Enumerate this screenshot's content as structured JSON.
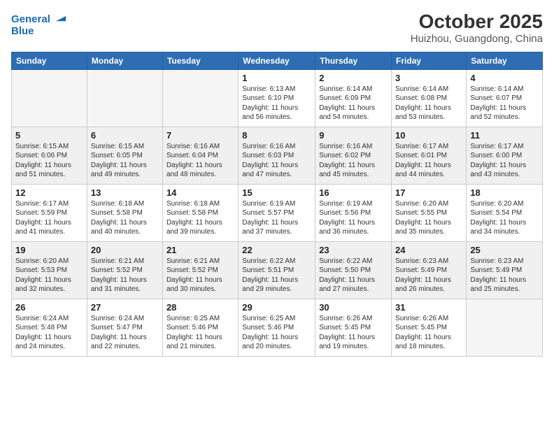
{
  "header": {
    "logo_line1": "General",
    "logo_line2": "Blue",
    "title": "October 2025",
    "subtitle": "Huizhou, Guangdong, China"
  },
  "weekdays": [
    "Sunday",
    "Monday",
    "Tuesday",
    "Wednesday",
    "Thursday",
    "Friday",
    "Saturday"
  ],
  "weeks": [
    [
      {
        "day": "",
        "info": ""
      },
      {
        "day": "",
        "info": ""
      },
      {
        "day": "",
        "info": ""
      },
      {
        "day": "1",
        "info": "Sunrise: 6:13 AM\nSunset: 6:10 PM\nDaylight: 11 hours and 56 minutes."
      },
      {
        "day": "2",
        "info": "Sunrise: 6:14 AM\nSunset: 6:09 PM\nDaylight: 11 hours and 54 minutes."
      },
      {
        "day": "3",
        "info": "Sunrise: 6:14 AM\nSunset: 6:08 PM\nDaylight: 11 hours and 53 minutes."
      },
      {
        "day": "4",
        "info": "Sunrise: 6:14 AM\nSunset: 6:07 PM\nDaylight: 11 hours and 52 minutes."
      }
    ],
    [
      {
        "day": "5",
        "info": "Sunrise: 6:15 AM\nSunset: 6:06 PM\nDaylight: 11 hours and 51 minutes."
      },
      {
        "day": "6",
        "info": "Sunrise: 6:15 AM\nSunset: 6:05 PM\nDaylight: 11 hours and 49 minutes."
      },
      {
        "day": "7",
        "info": "Sunrise: 6:16 AM\nSunset: 6:04 PM\nDaylight: 11 hours and 48 minutes."
      },
      {
        "day": "8",
        "info": "Sunrise: 6:16 AM\nSunset: 6:03 PM\nDaylight: 11 hours and 47 minutes."
      },
      {
        "day": "9",
        "info": "Sunrise: 6:16 AM\nSunset: 6:02 PM\nDaylight: 11 hours and 45 minutes."
      },
      {
        "day": "10",
        "info": "Sunrise: 6:17 AM\nSunset: 6:01 PM\nDaylight: 11 hours and 44 minutes."
      },
      {
        "day": "11",
        "info": "Sunrise: 6:17 AM\nSunset: 6:00 PM\nDaylight: 11 hours and 43 minutes."
      }
    ],
    [
      {
        "day": "12",
        "info": "Sunrise: 6:17 AM\nSunset: 5:59 PM\nDaylight: 11 hours and 41 minutes."
      },
      {
        "day": "13",
        "info": "Sunrise: 6:18 AM\nSunset: 5:58 PM\nDaylight: 11 hours and 40 minutes."
      },
      {
        "day": "14",
        "info": "Sunrise: 6:18 AM\nSunset: 5:58 PM\nDaylight: 11 hours and 39 minutes."
      },
      {
        "day": "15",
        "info": "Sunrise: 6:19 AM\nSunset: 5:57 PM\nDaylight: 11 hours and 37 minutes."
      },
      {
        "day": "16",
        "info": "Sunrise: 6:19 AM\nSunset: 5:56 PM\nDaylight: 11 hours and 36 minutes."
      },
      {
        "day": "17",
        "info": "Sunrise: 6:20 AM\nSunset: 5:55 PM\nDaylight: 11 hours and 35 minutes."
      },
      {
        "day": "18",
        "info": "Sunrise: 6:20 AM\nSunset: 5:54 PM\nDaylight: 11 hours and 34 minutes."
      }
    ],
    [
      {
        "day": "19",
        "info": "Sunrise: 6:20 AM\nSunset: 5:53 PM\nDaylight: 11 hours and 32 minutes."
      },
      {
        "day": "20",
        "info": "Sunrise: 6:21 AM\nSunset: 5:52 PM\nDaylight: 11 hours and 31 minutes."
      },
      {
        "day": "21",
        "info": "Sunrise: 6:21 AM\nSunset: 5:52 PM\nDaylight: 11 hours and 30 minutes."
      },
      {
        "day": "22",
        "info": "Sunrise: 6:22 AM\nSunset: 5:51 PM\nDaylight: 11 hours and 29 minutes."
      },
      {
        "day": "23",
        "info": "Sunrise: 6:22 AM\nSunset: 5:50 PM\nDaylight: 11 hours and 27 minutes."
      },
      {
        "day": "24",
        "info": "Sunrise: 6:23 AM\nSunset: 5:49 PM\nDaylight: 11 hours and 26 minutes."
      },
      {
        "day": "25",
        "info": "Sunrise: 6:23 AM\nSunset: 5:49 PM\nDaylight: 11 hours and 25 minutes."
      }
    ],
    [
      {
        "day": "26",
        "info": "Sunrise: 6:24 AM\nSunset: 5:48 PM\nDaylight: 11 hours and 24 minutes."
      },
      {
        "day": "27",
        "info": "Sunrise: 6:24 AM\nSunset: 5:47 PM\nDaylight: 11 hours and 22 minutes."
      },
      {
        "day": "28",
        "info": "Sunrise: 6:25 AM\nSunset: 5:46 PM\nDaylight: 11 hours and 21 minutes."
      },
      {
        "day": "29",
        "info": "Sunrise: 6:25 AM\nSunset: 5:46 PM\nDaylight: 11 hours and 20 minutes."
      },
      {
        "day": "30",
        "info": "Sunrise: 6:26 AM\nSunset: 5:45 PM\nDaylight: 11 hours and 19 minutes."
      },
      {
        "day": "31",
        "info": "Sunrise: 6:26 AM\nSunset: 5:45 PM\nDaylight: 11 hours and 18 minutes."
      },
      {
        "day": "",
        "info": ""
      }
    ]
  ]
}
